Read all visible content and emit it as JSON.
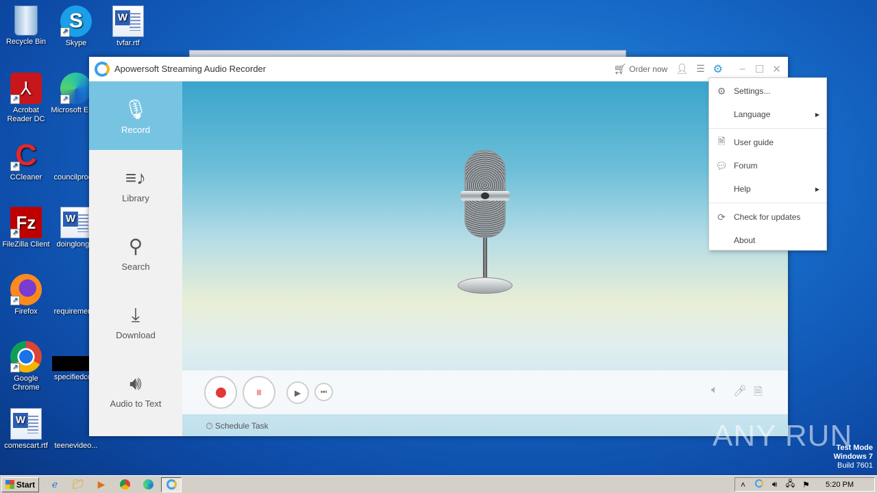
{
  "desktop_icons": [
    {
      "label": "Recycle Bin",
      "icon": "recycle-bin-icon"
    },
    {
      "label": "Skype",
      "icon": "skype-icon"
    },
    {
      "label": "tvfar.rtf",
      "icon": "word-document-icon"
    },
    {
      "label": "Acrobat Reader DC",
      "icon": "acrobat-icon"
    },
    {
      "label": "Microsoft Edge",
      "icon": "edge-icon"
    },
    {
      "label": "CCleaner",
      "icon": "ccleaner-icon"
    },
    {
      "label": "councilproc...",
      "icon": "document-icon"
    },
    {
      "label": "FileZilla Client",
      "icon": "filezilla-icon"
    },
    {
      "label": "doinglong...",
      "icon": "word-document-icon"
    },
    {
      "label": "Firefox",
      "icon": "firefox-icon"
    },
    {
      "label": "requiremen...",
      "icon": "document-icon"
    },
    {
      "label": "Google Chrome",
      "icon": "chrome-icon"
    },
    {
      "label": "specifiedco...",
      "icon": "document-icon"
    },
    {
      "label": "comescart.rtf",
      "icon": "word-document-icon"
    },
    {
      "label": "teenevideo...",
      "icon": "document-icon"
    }
  ],
  "app": {
    "title": "Apowersoft Streaming Audio Recorder",
    "order_now": "Order now",
    "accent_color": "#77c4e2",
    "nav": [
      {
        "label": "Record",
        "icon": "microphone-icon",
        "active": true
      },
      {
        "label": "Library",
        "icon": "library-icon",
        "active": false
      },
      {
        "label": "Search",
        "icon": "search-icon",
        "active": false
      },
      {
        "label": "Download",
        "icon": "download-icon",
        "active": false
      },
      {
        "label": "Audio to Text",
        "icon": "audio-to-text-icon",
        "active": false
      }
    ],
    "schedule_task": "Schedule Task"
  },
  "settings_menu": {
    "items": [
      {
        "label": "Settings...",
        "icon": "gear-icon"
      },
      {
        "label": "Language",
        "submenu": true
      },
      {
        "label": "User guide",
        "icon": "document-icon"
      },
      {
        "label": "Forum",
        "icon": "chat-icon"
      },
      {
        "label": "Help",
        "submenu": true
      },
      {
        "label": "Check for updates",
        "icon": "refresh-icon"
      },
      {
        "label": "About"
      }
    ]
  },
  "taskbar": {
    "start_label": "Start",
    "clock": "5:20 PM"
  },
  "watermark": {
    "line1": "Test Mode",
    "line2": "Windows 7",
    "line3": "Build 7601",
    "brand": "ANY RUN"
  }
}
